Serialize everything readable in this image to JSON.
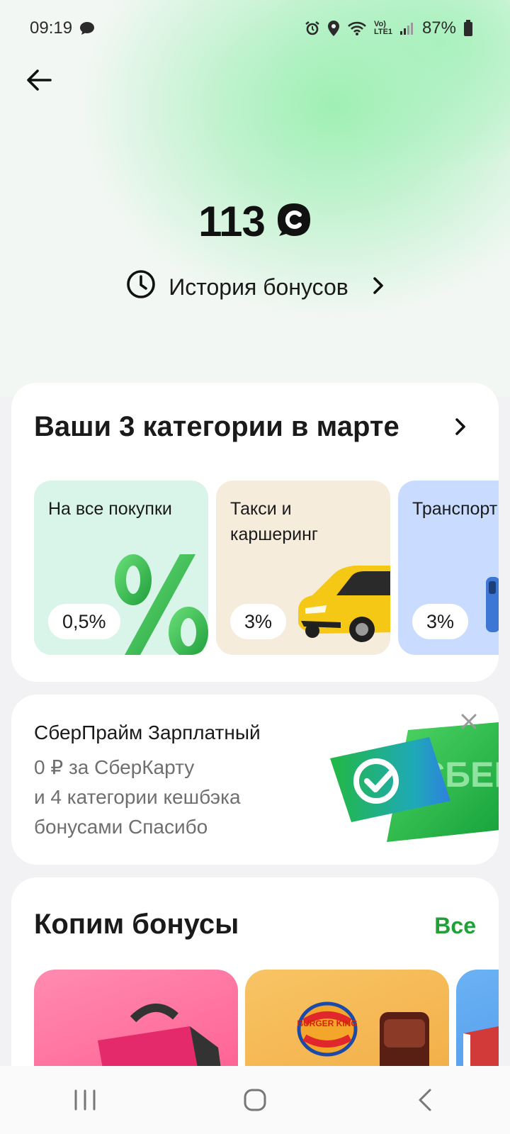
{
  "status_bar": {
    "time": "09:19",
    "battery": "87%",
    "network": "Vo) LTE1"
  },
  "header": {
    "back_icon": "arrow-left-icon",
    "balance": "113",
    "currency_icon": "spasibo-icon",
    "history_label": "История бонусов"
  },
  "categories": {
    "title": "Ваши 3 категории в марте",
    "items": [
      {
        "label": "На все покупки",
        "percent": "0,5%",
        "color": "#d9f5ea",
        "icon": "percent-3d-icon"
      },
      {
        "label": "Такси и каршеринг",
        "percent": "3%",
        "color": "#f6ecdc",
        "icon": "taxi-car-icon"
      },
      {
        "label": "Транспорт",
        "percent": "3%",
        "color": "#c9dcff",
        "icon": "transport-icon"
      }
    ]
  },
  "promo": {
    "title": "СберПрайм Зарплатный",
    "line1": "0 ₽ за СберКарту",
    "line2": "и 4 категории кешбэка",
    "line3": "бонусами Спасибо",
    "banner_text": "СБЕР"
  },
  "earn": {
    "title": "Копим бонусы",
    "all_label": "Все",
    "offers": [
      {
        "name": "pink-bag-offer",
        "color": "#ff6b9a"
      },
      {
        "name": "Burger King",
        "logo_text": "BURGER KING",
        "color": "#f5b74e"
      },
      {
        "name": "blue-offer",
        "color": "#5aa3ef"
      }
    ]
  },
  "colors": {
    "accent": "#21a038",
    "hero_green": "#9ff0b4"
  }
}
